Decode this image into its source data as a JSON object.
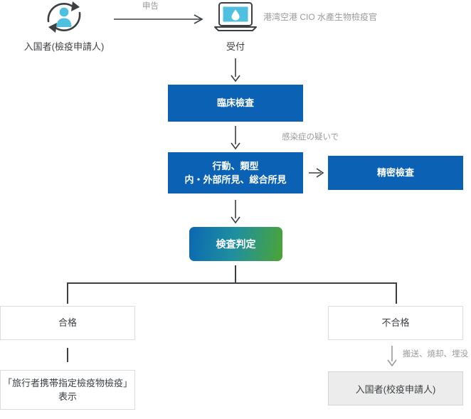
{
  "diagram": {
    "title": "港湾空港 CIO 水產生物檢疫官",
    "actors": {
      "applicant": {
        "icon": "person-cycle-icon",
        "label": "入国者(檢疫申請人)"
      },
      "reception": {
        "icon": "laptop-droplet-icon",
        "label": "受付",
        "note": "港湾空港 CIO 水產生物檢疫官"
      }
    },
    "edges": {
      "declare": "申告",
      "suspect_infection": "感染症の疑いで",
      "disposal": "搬送、燒却、埋没"
    },
    "steps": {
      "clinical_exam": "臨床檢査",
      "findings_line1": "行動、類型",
      "findings_line2": "内・外部所見、総合所見",
      "detailed_exam": "精密檢査",
      "judgement": "検査判定"
    },
    "outcomes": {
      "pass": "合格",
      "pass_result_line1": "「旅行者携帯指定檢疫物檢疫」",
      "pass_result_line2": "表示",
      "fail": "不合格",
      "fail_result": "入国者(校疫申請人)"
    },
    "colors": {
      "process_blue": "#0b62b5",
      "gradient_start": "#0b68b2",
      "gradient_end": "#4ca534",
      "icon_accent": "#4fc0e0",
      "icon_dark": "#3c4043",
      "connector": "#3c4043",
      "box_border": "#dcdcdc",
      "fill_gray": "#ececec",
      "text_gray": "#9a9a9a"
    }
  }
}
